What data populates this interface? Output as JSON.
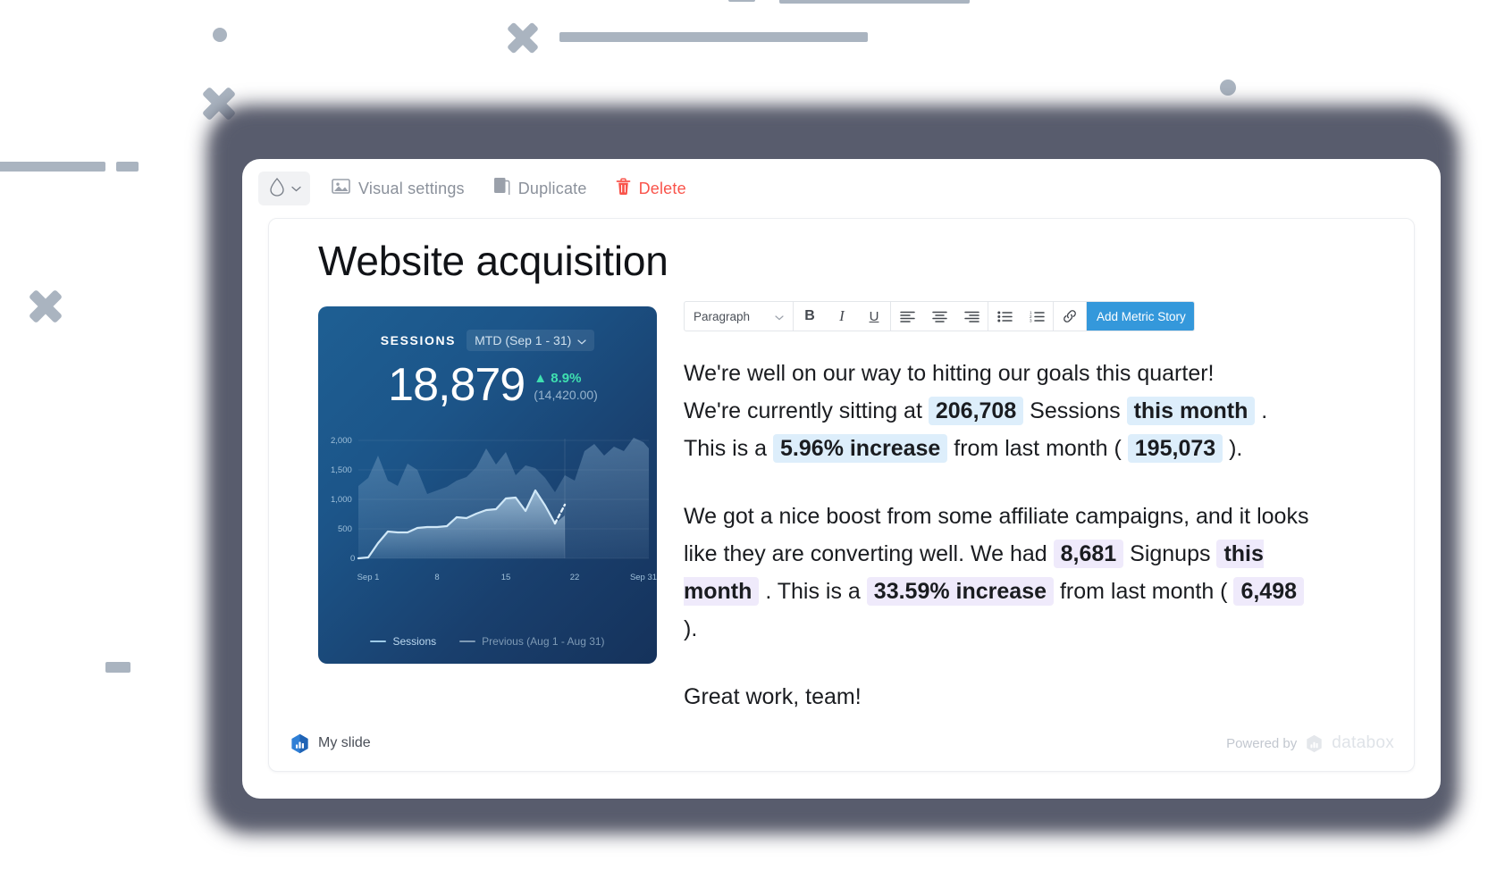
{
  "toolbar": {
    "droplet_icon": "droplet-icon",
    "droplet_chevron": "chevron-down-icon",
    "items": [
      {
        "icon": "image-icon",
        "label": "Visual settings"
      },
      {
        "icon": "duplicate-icon",
        "label": "Duplicate"
      },
      {
        "icon": "trash-icon",
        "label": "Delete",
        "color": "#f9544b"
      }
    ]
  },
  "slide": {
    "title": "Website acquisition",
    "footer_left_label": "My slide",
    "footer_powered_by": "Powered by",
    "footer_brand": "databox"
  },
  "metric_card": {
    "label": "SESSIONS",
    "date_range": "MTD (Sep 1 - 31)",
    "value": "18,879",
    "delta": "▲ 8.9%",
    "delta_color": "#3fe0b0",
    "previous_value": "(14,420.00)",
    "legend": [
      {
        "name": "Sessions",
        "color": "#9ecbe8"
      },
      {
        "name": "Previous (Aug 1 - Aug 31)",
        "color": "#7e9ab5"
      }
    ]
  },
  "chart_data": {
    "type": "area",
    "title": "Sessions",
    "xlabel": "",
    "ylabel": "",
    "ylim": [
      0,
      2200
    ],
    "yticks": [
      "0",
      "500",
      "1,000",
      "1,500",
      "2,000"
    ],
    "ytick_values": [
      0,
      500,
      1000,
      1500,
      2000
    ],
    "xticks": [
      "Sep 1",
      "8",
      "15",
      "22",
      "Sep 31"
    ],
    "xtick_values": [
      1,
      8,
      15,
      22,
      31
    ],
    "grid": false,
    "legend_position": "bottom",
    "x": [
      1,
      2,
      3,
      4,
      5,
      6,
      7,
      8,
      9,
      10,
      11,
      12,
      13,
      14,
      15,
      16,
      17,
      18,
      19,
      20,
      21,
      22,
      23,
      24,
      25,
      26,
      27,
      28,
      29,
      30,
      31
    ],
    "series": [
      {
        "name": "Sessions",
        "color": "#9ecbe8",
        "values": [
          0,
          10,
          260,
          450,
          430,
          440,
          520,
          530,
          530,
          545,
          700,
          690,
          760,
          820,
          830,
          1010,
          1030,
          800,
          1150,
          900,
          600,
          740,
          null,
          null,
          null,
          null,
          null,
          null,
          null,
          null,
          null
        ]
      },
      {
        "name": "Previous (Aug 1 - Aug 31)",
        "color": "#7e9ab5",
        "values": [
          1400,
          1520,
          1820,
          1500,
          1430,
          1750,
          1660,
          1330,
          1380,
          1420,
          1500,
          1560,
          1680,
          1920,
          1700,
          1880,
          1550,
          1670,
          1620,
          1500,
          1300,
          1550,
          1480,
          1880,
          1990,
          1840,
          1960,
          1880,
          2060,
          2000,
          1900
        ]
      }
    ],
    "forecast_note": "dashed projection from day 21 to day 22"
  },
  "editor_toolbar": {
    "paragraph_style": "Paragraph",
    "paragraph_chevron": "chevron-down-icon",
    "bold": "B",
    "italic": "I",
    "underline": "U",
    "align_left": "align-left-icon",
    "align_center": "align-center-icon",
    "align_right": "align-right-icon",
    "bullet_list": "bullet-list-icon",
    "numbered_list": "numbered-list-icon",
    "link": "link-icon",
    "add_metric_story": "Add Metric Story",
    "add_metric_chevron": "chevron-down-icon",
    "accent_color": "#3498db"
  },
  "body": {
    "p1_l1": "We're well on our way to hitting our goals this quarter!",
    "p1_a": "We're currently sitting at ",
    "p1_m1": "206,708",
    "p1_b": " Sessions ",
    "p1_m2": "this month",
    "p1_c": " . This is a ",
    "p1_m3": "5.96% increase",
    "p1_d": " from last month ( ",
    "p1_m4": "195,073",
    "p1_e": " ).",
    "p2_a": "We got a nice boost from some affiliate campaigns, and it looks like they are converting well. We had ",
    "p2_m1": "8,681",
    "p2_b": " Signups ",
    "p2_m2": "this month",
    "p2_c": " . This is a ",
    "p2_m3": "33.59% increase",
    "p2_d": " from last month ( ",
    "p2_m4": "6,498",
    "p2_e": " ).",
    "p3": "Great work, team!",
    "highlight_blue": "#ddeefb",
    "highlight_purple": "#efeafb"
  }
}
